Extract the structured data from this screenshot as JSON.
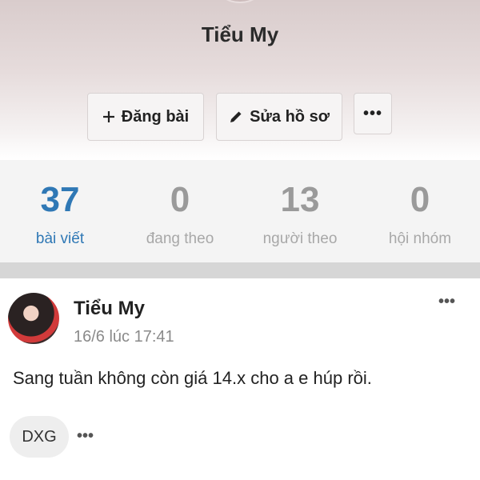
{
  "profile": {
    "name": "Tiểu My"
  },
  "actions": {
    "post_label": "Đăng bài",
    "edit_label": "Sửa hồ sơ",
    "more_label": "•••"
  },
  "stats": [
    {
      "value": "37",
      "label": "bài viết"
    },
    {
      "value": "0",
      "label": "đang theo"
    },
    {
      "value": "13",
      "label": "người theo"
    },
    {
      "value": "0",
      "label": "hội nhóm"
    }
  ],
  "post": {
    "author": "Tiểu My",
    "time": "16/6 lúc 17:41",
    "menu": "•••",
    "text": "Sang tuần không còn giá 14.x cho a e húp rồi.",
    "tag": "DXG",
    "more": "•••"
  },
  "colors": {
    "accent": "#2f78b5",
    "muted": "#9a9a9a",
    "stats_bg": "#f4f4f4",
    "divider": "#d6d6d6"
  },
  "icons": [
    "plus-icon",
    "pencil-icon",
    "more-icon"
  ]
}
